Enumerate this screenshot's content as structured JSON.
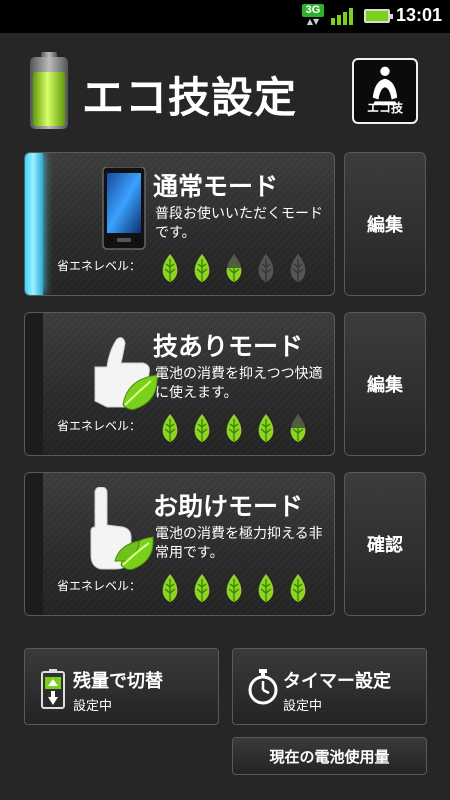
{
  "statusbar": {
    "network": "3G",
    "time": "13:01"
  },
  "header": {
    "title": "エコ技設定",
    "eco_logo_text": "eco",
    "eco_label": "エコ技"
  },
  "level_label": "省エネレベル：",
  "modes": [
    {
      "title": "通常モード",
      "desc": "普段お使いいただくモードです。",
      "action": "編集",
      "level_filled": 2.5,
      "level_max": 5,
      "active": true
    },
    {
      "title": "技ありモード",
      "desc": "電池の消費を抑えつつ快適に使えます。",
      "action": "編集",
      "level_filled": 4.5,
      "level_max": 5,
      "active": false
    },
    {
      "title": "お助けモード",
      "desc": "電池の消費を極力抑える非常用です。",
      "action": "確認",
      "level_filled": 5,
      "level_max": 5,
      "active": false
    }
  ],
  "bottom": {
    "remaining": {
      "title": "残量で切替",
      "status": "設定中"
    },
    "timer": {
      "title": "タイマー設定",
      "status": "設定中"
    },
    "usage_label": "現在の電池使用量"
  },
  "colors": {
    "leaf_on": "#8dd61f",
    "leaf_off": "#555555",
    "accent": "#3ad6ff"
  }
}
